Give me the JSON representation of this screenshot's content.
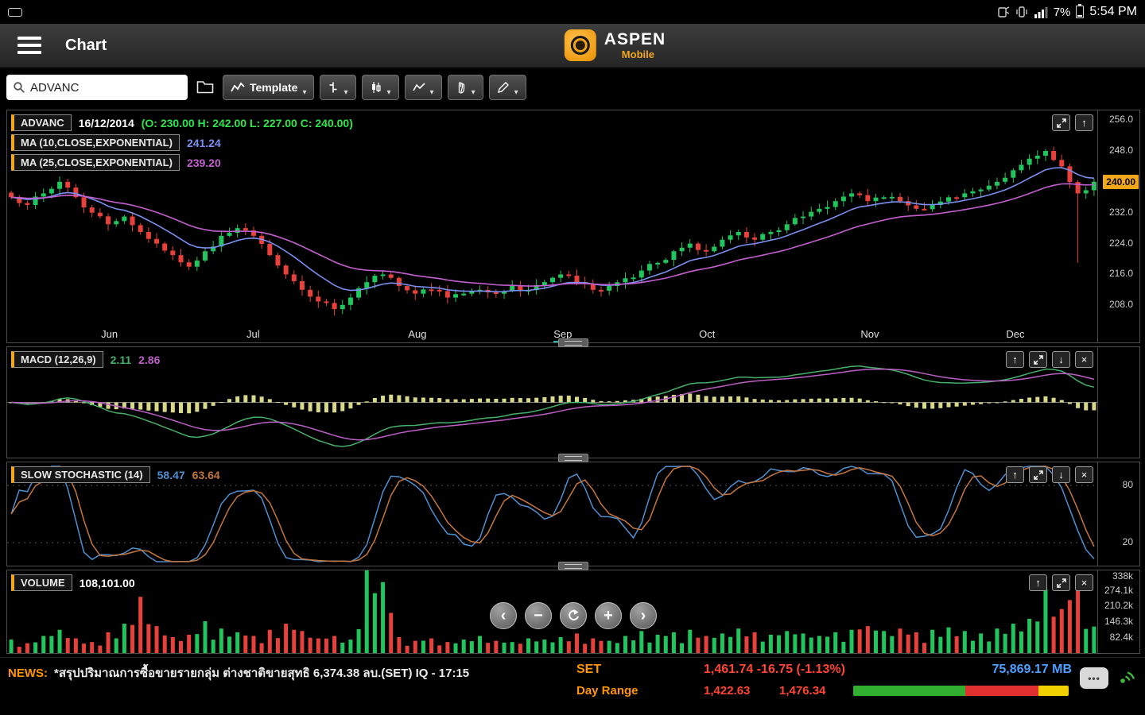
{
  "status_bar": {
    "battery_percent": "7%",
    "time": "5:54 PM"
  },
  "header": {
    "title": "Chart",
    "logo_title": "ASPEN",
    "logo_subtitle": "Mobile"
  },
  "toolbar": {
    "search_value": "ADVANC",
    "template_label": "Template"
  },
  "main_chart": {
    "symbol": "ADVANC",
    "date": "16/12/2014",
    "ohlc": "(O: 230.00 H: 242.00 L: 227.00 C: 240.00)",
    "ma1_label": "MA (10,CLOSE,EXPONENTIAL)",
    "ma1_value": "241.24",
    "ma2_label": "MA (25,CLOSE,EXPONENTIAL)",
    "ma2_value": "239.20",
    "price_badge": "240.00"
  },
  "macd": {
    "label": "MACD (12,26,9)",
    "value1": "2.11",
    "value2": "2.86"
  },
  "stochastic": {
    "label": "SLOW STOCHASTIC (14)",
    "value1": "58.47",
    "value2": "63.64"
  },
  "volume": {
    "label": "VOLUME",
    "value": "108,101.00"
  },
  "news": {
    "label": "NEWS:",
    "text": "*สรุปปริมาณการซื้อขายรายกลุ่ม ต่างชาติขายสุทธิ 6,374.38 ลบ.(SET)  IQ - 17:15"
  },
  "market": {
    "set_label": "SET",
    "set_value": "1,461.74 -16.75 (-1.13%)",
    "set_volume": "75,869.17 MB",
    "day_range_label": "Day Range",
    "day_low": "1,422.63",
    "day_high": "1,476.34",
    "range_segments": [
      {
        "pct": 52,
        "color": "#2fae2f"
      },
      {
        "pct": 34,
        "color": "#e03030"
      },
      {
        "pct": 14,
        "color": "#f0d000"
      }
    ]
  },
  "colors": {
    "accent": "#f2a71b",
    "candle_up": "#21c55d",
    "candle_down": "#e8403a",
    "ma10": "#7b8ff0",
    "ma25": "#c45fd0",
    "macd_line": "#45b06a",
    "macd_signal": "#bb5fc5",
    "macd_hist": "#d8d88a",
    "stoch_k": "#4f8fd0",
    "stoch_d": "#c5763d",
    "set_red": "#ff4436",
    "mb_blue": "#4d9fff",
    "news_orange": "#ff9500"
  },
  "chart_data": {
    "type": "candlestick",
    "symbol": "ADVANC",
    "period": "Jun 2014 - Dec 2014, daily",
    "last_bar": {
      "date": "16/12/2014",
      "open": 230.0,
      "high": 242.0,
      "low": 227.0,
      "close": 240.0
    },
    "overlays": [
      {
        "name": "EMA",
        "period": 10,
        "last_value": 241.24
      },
      {
        "name": "EMA",
        "period": 25,
        "last_value": 239.2
      }
    ],
    "price_ticks": [
      256,
      248,
      240,
      232,
      224,
      216,
      208
    ],
    "price_domain": [
      202.5,
      258.5
    ],
    "closes": [
      236,
      234,
      237,
      240,
      236,
      232,
      229,
      231,
      227,
      224,
      221,
      218,
      222,
      226,
      228,
      226,
      221,
      216,
      212,
      209,
      207,
      210,
      214,
      216,
      213,
      211,
      212,
      210,
      211,
      212,
      211,
      213,
      212,
      214,
      216,
      214,
      212,
      213,
      215,
      217,
      219,
      222,
      224,
      222,
      225,
      227,
      225,
      227,
      229,
      231,
      233,
      235,
      237,
      235,
      236,
      235,
      233,
      234,
      236,
      237,
      238,
      240,
      243,
      246,
      248,
      244,
      237,
      240
    ],
    "volumes_k": [
      55,
      40,
      70,
      95,
      60,
      45,
      85,
      120,
      230,
      110,
      65,
      75,
      130,
      100,
      85,
      70,
      95,
      120,
      90,
      60,
      70,
      55,
      338,
      290,
      65,
      50,
      60,
      45,
      55,
      70,
      50,
      45,
      60,
      55,
      65,
      80,
      60,
      50,
      70,
      90,
      75,
      85,
      95,
      70,
      80,
      100,
      85,
      75,
      90,
      80,
      70,
      85,
      95,
      110,
      90,
      100,
      85,
      95,
      105,
      90,
      80,
      100,
      120,
      140,
      260,
      180,
      300,
      108.1
    ],
    "low_overrides": {
      "66": 219
    },
    "volume_axis_max_k": 338,
    "volume_ticks_k": [
      338,
      274.1,
      210.2,
      146.3,
      82.4
    ],
    "macd": {
      "fast": 12,
      "slow": 26,
      "signal": 9,
      "last_macd": 2.11,
      "last_signal": 2.86
    },
    "stochastic": {
      "period": 14,
      "last_k": 58.47,
      "last_d": 63.64,
      "ticks": [
        80,
        20
      ]
    },
    "months": [
      {
        "label": "Jun",
        "i": 2
      },
      {
        "label": "Jul",
        "i": 11
      },
      {
        "label": "Aug",
        "i": 21
      },
      {
        "label": "Sep",
        "i": 30
      },
      {
        "label": "Oct",
        "i": 39
      },
      {
        "label": "Nov",
        "i": 49
      },
      {
        "label": "Dec",
        "i": 58
      }
    ],
    "highlight_month": "Sep"
  }
}
